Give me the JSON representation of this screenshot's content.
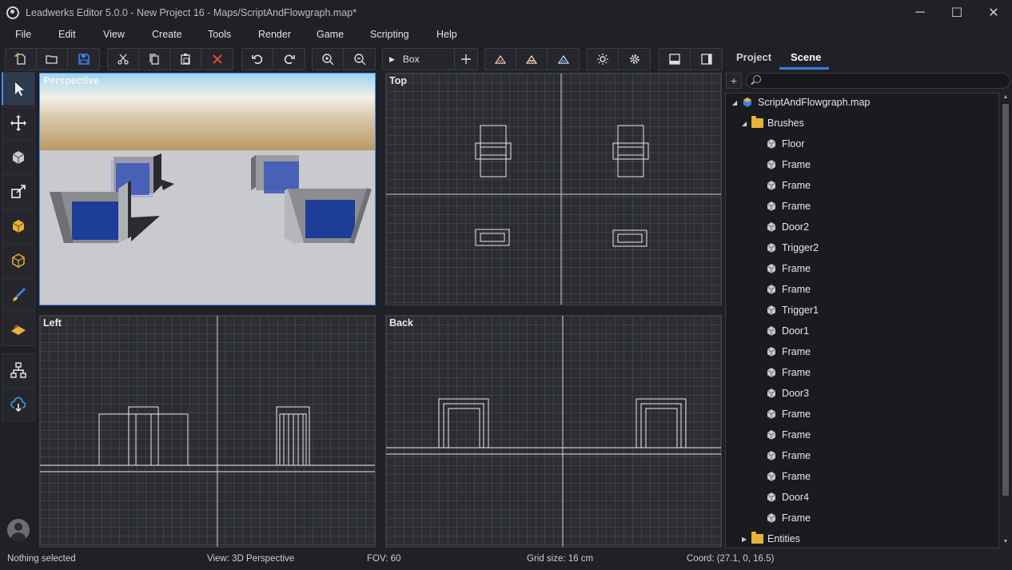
{
  "window": {
    "title": "Leadwerks Editor 5.0.0 - New Project 16 - Maps/ScriptAndFlowgraph.map*"
  },
  "menu": [
    "File",
    "Edit",
    "View",
    "Create",
    "Tools",
    "Render",
    "Game",
    "Scripting",
    "Help"
  ],
  "toolbar": {
    "shape_select": "Box"
  },
  "viewports": {
    "perspective": "Perspective",
    "top": "Top",
    "left": "Left",
    "back": "Back"
  },
  "panel": {
    "tabs": [
      "Project",
      "Scene"
    ],
    "active_tab": "Scene",
    "search_placeholder": "",
    "tree": {
      "root": "ScriptAndFlowgraph.map",
      "brushes_folder": "Brushes",
      "brushes": [
        "Floor",
        "Frame",
        "Frame",
        "Frame",
        "Door2",
        "Trigger2",
        "Frame",
        "Frame",
        "Trigger1",
        "Door1",
        "Frame",
        "Frame",
        "Door3",
        "Frame",
        "Frame",
        "Frame",
        "Frame",
        "Door4",
        "Frame"
      ],
      "entities_folder": "Entities"
    }
  },
  "status": {
    "selection": "Nothing selected",
    "view": "View: 3D Perspective",
    "fov": "FOV: 60",
    "grid": "Grid size: 16 cm",
    "coord": "Coord: (27.1, 0, 16.5)"
  },
  "colors": {
    "accent": "#3d7de0",
    "active_border": "#4a8ef0",
    "folder": "#e8b23a",
    "delete_icon": "#e04a3a",
    "save_icon": "#3d7de0"
  }
}
